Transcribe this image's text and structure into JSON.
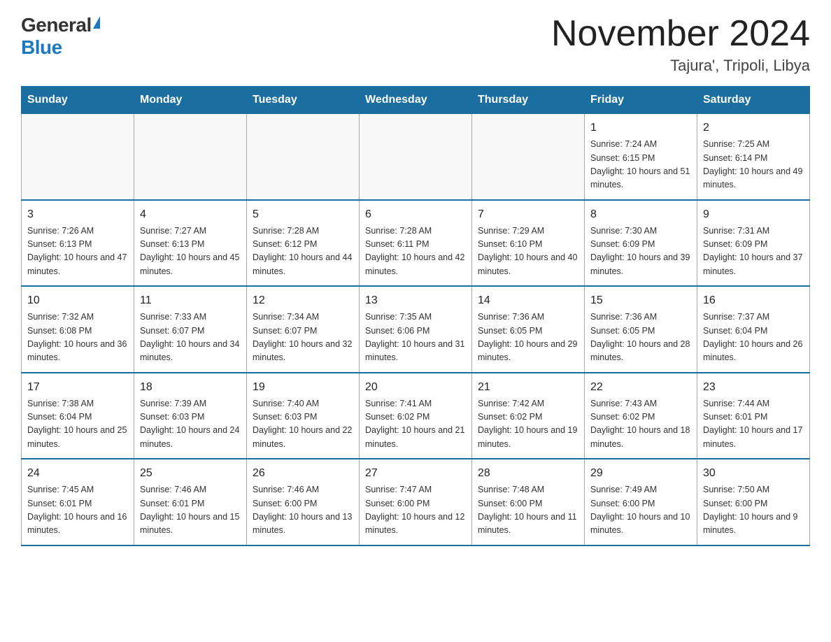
{
  "logo": {
    "general": "General",
    "blue": "Blue"
  },
  "title": "November 2024",
  "location": "Tajura', Tripoli, Libya",
  "days_of_week": [
    "Sunday",
    "Monday",
    "Tuesday",
    "Wednesday",
    "Thursday",
    "Friday",
    "Saturday"
  ],
  "weeks": [
    [
      {
        "day": "",
        "info": ""
      },
      {
        "day": "",
        "info": ""
      },
      {
        "day": "",
        "info": ""
      },
      {
        "day": "",
        "info": ""
      },
      {
        "day": "",
        "info": ""
      },
      {
        "day": "1",
        "info": "Sunrise: 7:24 AM\nSunset: 6:15 PM\nDaylight: 10 hours and 51 minutes."
      },
      {
        "day": "2",
        "info": "Sunrise: 7:25 AM\nSunset: 6:14 PM\nDaylight: 10 hours and 49 minutes."
      }
    ],
    [
      {
        "day": "3",
        "info": "Sunrise: 7:26 AM\nSunset: 6:13 PM\nDaylight: 10 hours and 47 minutes."
      },
      {
        "day": "4",
        "info": "Sunrise: 7:27 AM\nSunset: 6:13 PM\nDaylight: 10 hours and 45 minutes."
      },
      {
        "day": "5",
        "info": "Sunrise: 7:28 AM\nSunset: 6:12 PM\nDaylight: 10 hours and 44 minutes."
      },
      {
        "day": "6",
        "info": "Sunrise: 7:28 AM\nSunset: 6:11 PM\nDaylight: 10 hours and 42 minutes."
      },
      {
        "day": "7",
        "info": "Sunrise: 7:29 AM\nSunset: 6:10 PM\nDaylight: 10 hours and 40 minutes."
      },
      {
        "day": "8",
        "info": "Sunrise: 7:30 AM\nSunset: 6:09 PM\nDaylight: 10 hours and 39 minutes."
      },
      {
        "day": "9",
        "info": "Sunrise: 7:31 AM\nSunset: 6:09 PM\nDaylight: 10 hours and 37 minutes."
      }
    ],
    [
      {
        "day": "10",
        "info": "Sunrise: 7:32 AM\nSunset: 6:08 PM\nDaylight: 10 hours and 36 minutes."
      },
      {
        "day": "11",
        "info": "Sunrise: 7:33 AM\nSunset: 6:07 PM\nDaylight: 10 hours and 34 minutes."
      },
      {
        "day": "12",
        "info": "Sunrise: 7:34 AM\nSunset: 6:07 PM\nDaylight: 10 hours and 32 minutes."
      },
      {
        "day": "13",
        "info": "Sunrise: 7:35 AM\nSunset: 6:06 PM\nDaylight: 10 hours and 31 minutes."
      },
      {
        "day": "14",
        "info": "Sunrise: 7:36 AM\nSunset: 6:05 PM\nDaylight: 10 hours and 29 minutes."
      },
      {
        "day": "15",
        "info": "Sunrise: 7:36 AM\nSunset: 6:05 PM\nDaylight: 10 hours and 28 minutes."
      },
      {
        "day": "16",
        "info": "Sunrise: 7:37 AM\nSunset: 6:04 PM\nDaylight: 10 hours and 26 minutes."
      }
    ],
    [
      {
        "day": "17",
        "info": "Sunrise: 7:38 AM\nSunset: 6:04 PM\nDaylight: 10 hours and 25 minutes."
      },
      {
        "day": "18",
        "info": "Sunrise: 7:39 AM\nSunset: 6:03 PM\nDaylight: 10 hours and 24 minutes."
      },
      {
        "day": "19",
        "info": "Sunrise: 7:40 AM\nSunset: 6:03 PM\nDaylight: 10 hours and 22 minutes."
      },
      {
        "day": "20",
        "info": "Sunrise: 7:41 AM\nSunset: 6:02 PM\nDaylight: 10 hours and 21 minutes."
      },
      {
        "day": "21",
        "info": "Sunrise: 7:42 AM\nSunset: 6:02 PM\nDaylight: 10 hours and 19 minutes."
      },
      {
        "day": "22",
        "info": "Sunrise: 7:43 AM\nSunset: 6:02 PM\nDaylight: 10 hours and 18 minutes."
      },
      {
        "day": "23",
        "info": "Sunrise: 7:44 AM\nSunset: 6:01 PM\nDaylight: 10 hours and 17 minutes."
      }
    ],
    [
      {
        "day": "24",
        "info": "Sunrise: 7:45 AM\nSunset: 6:01 PM\nDaylight: 10 hours and 16 minutes."
      },
      {
        "day": "25",
        "info": "Sunrise: 7:46 AM\nSunset: 6:01 PM\nDaylight: 10 hours and 15 minutes."
      },
      {
        "day": "26",
        "info": "Sunrise: 7:46 AM\nSunset: 6:00 PM\nDaylight: 10 hours and 13 minutes."
      },
      {
        "day": "27",
        "info": "Sunrise: 7:47 AM\nSunset: 6:00 PM\nDaylight: 10 hours and 12 minutes."
      },
      {
        "day": "28",
        "info": "Sunrise: 7:48 AM\nSunset: 6:00 PM\nDaylight: 10 hours and 11 minutes."
      },
      {
        "day": "29",
        "info": "Sunrise: 7:49 AM\nSunset: 6:00 PM\nDaylight: 10 hours and 10 minutes."
      },
      {
        "day": "30",
        "info": "Sunrise: 7:50 AM\nSunset: 6:00 PM\nDaylight: 10 hours and 9 minutes."
      }
    ]
  ]
}
